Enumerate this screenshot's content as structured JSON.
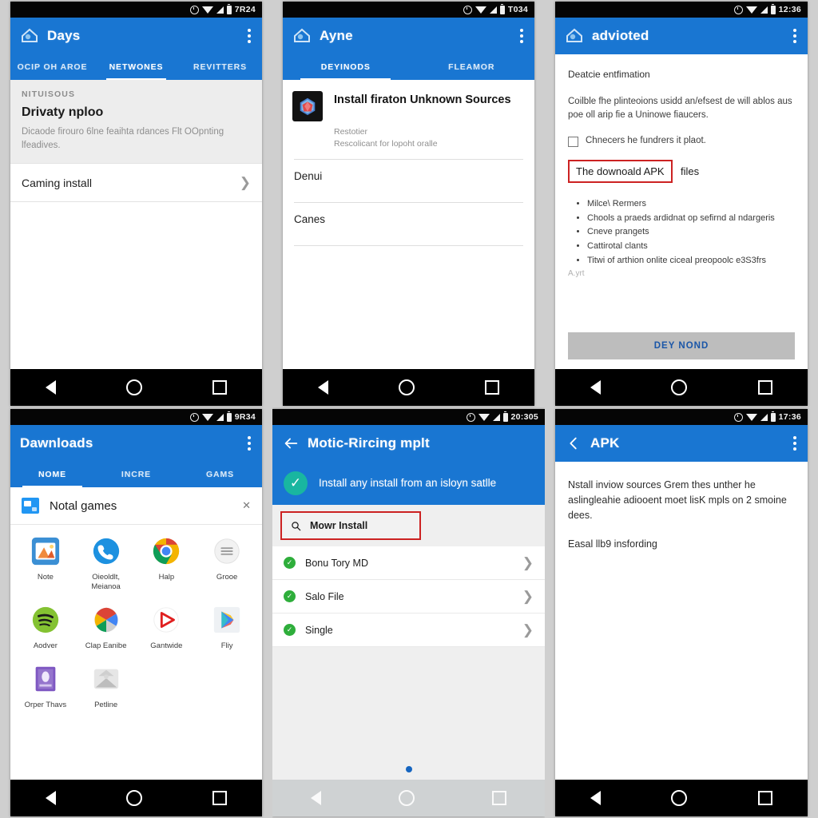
{
  "meta": {
    "accent_blue": "#1976d2",
    "highlight_red": "#cc2222",
    "status_bar_black": "#050505"
  },
  "panels": [
    {
      "id": "panel-settings-days",
      "status_time": "7R24",
      "appbar": {
        "title": "Days",
        "logo_icon": "home-shield-icon",
        "overflow_icon": "kebab-menu-icon"
      },
      "tabs": [
        {
          "label": "OCIP OH AROE",
          "active": false
        },
        {
          "label": "NETWONES",
          "active": true
        },
        {
          "label": "REVITTERS",
          "active": false
        }
      ],
      "section": {
        "label": "NITUISOUS",
        "title": "Drivaty nploo",
        "desc": "Dicaode firouro 6lne feaihta rdances Flt OOpnting lfeadives."
      },
      "row": {
        "title": "Caming install",
        "chevron": "chevron-right-icon"
      }
    },
    {
      "id": "panel-ayne-unknown-sources",
      "status_time": "T034",
      "appbar": {
        "title": "Ayne",
        "logo_icon": "home-shield-icon",
        "overflow_icon": "kebab-menu-icon"
      },
      "tabs": [
        {
          "label": "DEYINODS",
          "active": true
        },
        {
          "label": "FLEAMOR",
          "active": false
        }
      ],
      "header": {
        "icon": "gem-app-icon",
        "title": "Install firaton Unknown Sources",
        "sub1": "Restotier",
        "sub2": "Rescolicant for lopoht oralle"
      },
      "items": [
        {
          "label": "Denui"
        },
        {
          "label": "Canes"
        }
      ]
    },
    {
      "id": "panel-advioted-apk",
      "status_time": "12:36",
      "appbar": {
        "title": "advioted",
        "logo_icon": "home-shield-icon",
        "overflow_icon": "kebab-menu-icon"
      },
      "lead": "Deatcie entfimation",
      "para": "Coilble fhe plinteoions usidd an/efsest de will ablos aus poe oll arip fie a Uninowe fiaucers.",
      "checkbox": {
        "label": "Chnecers he fundrers it plaot.",
        "checked": false
      },
      "highlight": {
        "text": "The downoald APK",
        "after": "files"
      },
      "bullets": [
        "Milce\\ Rermers",
        "Chools a praeds ardidnat op sefirnd al ndargeris",
        "Cneve prangets",
        "Cattirotal clants",
        "Titwi of arthion onlite ciceal preopoolc e3S3frs"
      ],
      "footnote": "A.yrt",
      "button": {
        "label": "DEY NOND"
      }
    },
    {
      "id": "panel-downloads-apps",
      "status_time": "9R34",
      "appbar": {
        "title": "Dawnloads",
        "logo_icon": "none",
        "overflow_icon": "kebab-menu-icon"
      },
      "tabs": [
        {
          "label": "NOME",
          "active": true
        },
        {
          "label": "INCRE",
          "active": false
        },
        {
          "label": "GAMS",
          "active": false
        }
      ],
      "folder": {
        "name": "Notal games",
        "icon": "folder-icon",
        "chevron": "chevron-down-icon"
      },
      "apps": [
        {
          "name": "Note",
          "icon": "photos-icon"
        },
        {
          "name": "Oieoldlt, Meianoa",
          "icon": "phone-icon"
        },
        {
          "name": "Halp",
          "icon": "chrome-icon"
        },
        {
          "name": "Grooe",
          "icon": "menu-circle-icon"
        },
        {
          "name": "Aodver",
          "icon": "spotify-icon"
        },
        {
          "name": "Clap Eanibe",
          "icon": "photos-pinwheel-icon"
        },
        {
          "name": "Gantwide",
          "icon": "youtube-icon"
        },
        {
          "name": "Fliy",
          "icon": "play-store-icon"
        },
        {
          "name": "Orper Thavs",
          "icon": "book-icon"
        },
        {
          "name": "Petline",
          "icon": "mail-icon"
        }
      ]
    },
    {
      "id": "panel-motic-install",
      "status_time": "20:305",
      "appbar": {
        "title": "Motic-Rircing mplt",
        "back_icon": "arrow-back-icon"
      },
      "banner": {
        "icon": "check-circle-icon",
        "text": "Install any install from an isloyn satlle"
      },
      "search": {
        "icon": "search-icon",
        "value": "Mowr Install"
      },
      "rows": [
        {
          "label": "Bonu Tory MD",
          "icon": "check-circle-green-icon",
          "chevron": "chevron-right-icon"
        },
        {
          "label": "Salo File",
          "icon": "check-circle-green-icon",
          "chevron": "chevron-right-icon"
        },
        {
          "label": "Single",
          "icon": "check-circle-green-icon",
          "chevron": "chevron-right-icon"
        }
      ],
      "page_dot": "page-indicator-dot"
    },
    {
      "id": "panel-apk-info",
      "status_time": "17:36",
      "appbar": {
        "title": "APK",
        "back_icon": "chevron-back-icon",
        "overflow_icon": "kebab-menu-icon"
      },
      "paragraphs": [
        "Nstall inviow sources\nGrem thes unther he aslingleahie adiooent moet lisK mpls on 2 smoine dees.",
        "Easal llb9 insfording"
      ]
    }
  ],
  "navbar": {
    "back": "nav-back-icon",
    "home": "nav-home-icon",
    "recents": "nav-recents-icon"
  }
}
